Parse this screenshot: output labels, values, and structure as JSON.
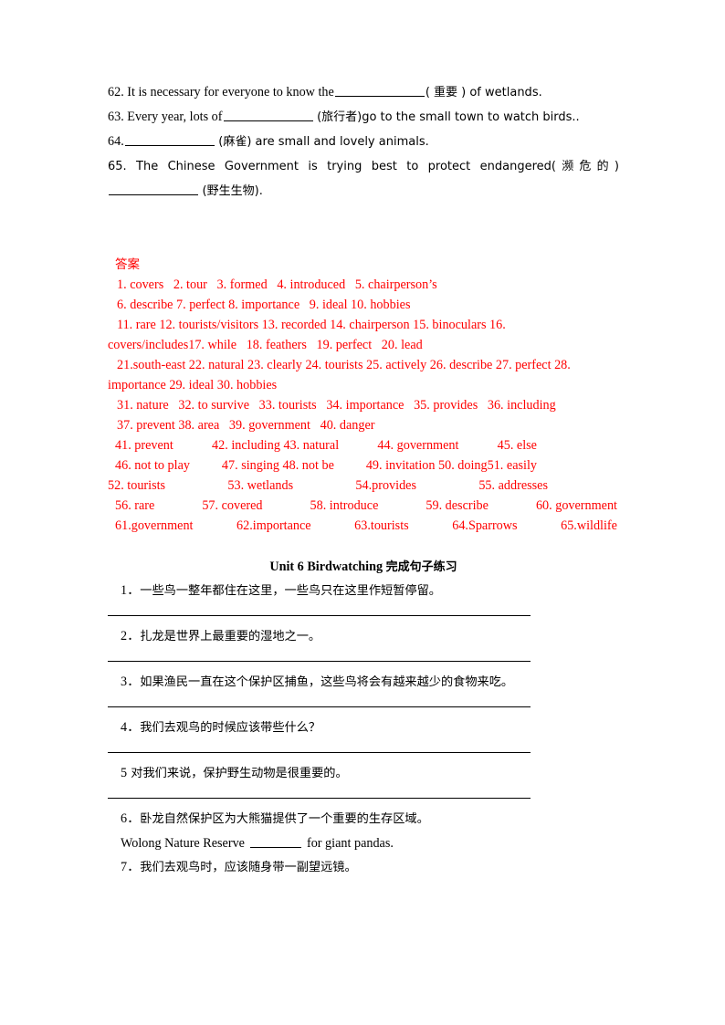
{
  "document": {
    "top_questions": [
      {
        "number": "62.",
        "before": "62. It is necessary for everyone to know the",
        "after": "(  重要  ) of wetlands."
      },
      {
        "number": "63.",
        "before": "63. Every year, lots of",
        "after": "(旅行者)go to the small town to watch birds.."
      },
      {
        "number": "64.",
        "before": "64.",
        "after": "(麻雀) are small and lovely animals."
      },
      {
        "number": "65.",
        "before": "65. The Chinese Government is trying best to protect endangered(濒危的)",
        "after": "(野生生物)."
      }
    ],
    "answer_key": {
      "heading": "答案",
      "color": "#ff0000",
      "rows": [
        {
          "style": "indent",
          "text": "1. covers   2. tour   3. formed   4. introduced   5. chairperson’s"
        },
        {
          "style": "indent",
          "text": "6. describe 7. perfect 8. importance   9. ideal 10. hobbies"
        },
        {
          "style": "justify",
          "text": "11.  rare   12.  tourists/visitors   13.  recorded   14.  chairperson   15.  binoculars   16."
        },
        {
          "style": "flush",
          "text": "covers/includes17. while   18. feathers   19. perfect   20. lead"
        },
        {
          "style": "justify",
          "text": "21.south-east  22.  natural 23.  clearly 24.  tourists 25.  actively 26.  describe 27.  perfect 28."
        },
        {
          "style": "flush",
          "text": "importance 29. ideal 30. hobbies"
        },
        {
          "style": "indent",
          "text": "31. nature   32. to survive   33. tourists   34. importance   35. provides   36. including"
        },
        {
          "style": "indent",
          "text": "37. prevent 38. area   39. government   40. danger"
        },
        {
          "style": "spread-tight",
          "cells": [
            "41. prevent",
            "42. including 43. natural",
            "44. government",
            "45. else"
          ]
        },
        {
          "style": "spread-tight",
          "cells": [
            "46. not to play",
            "47. singing   48. not be",
            "49. invitation 50. doing51. easily"
          ]
        },
        {
          "style": "spread-left",
          "cells": [
            "52. tourists",
            "53. wetlands",
            "54.provides",
            "55. addresses"
          ]
        },
        {
          "style": "spread",
          "cells": [
            "56. rare",
            "57. covered",
            "58. introduce",
            "59. describe",
            "60. government"
          ]
        },
        {
          "style": "spread",
          "cells": [
            "61.government",
            "62.importance",
            "63.tourists",
            "64.Sparrows",
            "65.wildlife"
          ]
        }
      ]
    },
    "unit_section": {
      "title_en": "Unit 6 Birdwatching ",
      "title_cn": "完成句子练习",
      "exercises": [
        {
          "num": "1．",
          "text": "一些鸟一整年都住在这里，一些鸟只在这里作短暂停留。",
          "rule": true
        },
        {
          "num": "2．",
          "text": "扎龙是世界上最重要的湿地之一。",
          "rule": true
        },
        {
          "num": "3．",
          "text": "如果渔民一直在这个保护区捕鱼，这些鸟将会有越来越少的食物来吃。",
          "rule": true
        },
        {
          "num": "4．",
          "text": "我们去观鸟的时候应该带些什么？",
          "rule": true
        },
        {
          "num": "5",
          "text": " 对我们来说，保护野生动物是很重要的。",
          "rule": true
        },
        {
          "num": "6．",
          "text": "卧龙自然保护区为大熊猫提供了一个重要的生存区域。",
          "rule": false,
          "sub_before": "Wolong Nature Reserve",
          "sub_after": "for giant pandas."
        },
        {
          "num": "7．",
          "text": "我们去观鸟时，应该随身带一副望远镜。",
          "rule": false
        }
      ]
    }
  }
}
